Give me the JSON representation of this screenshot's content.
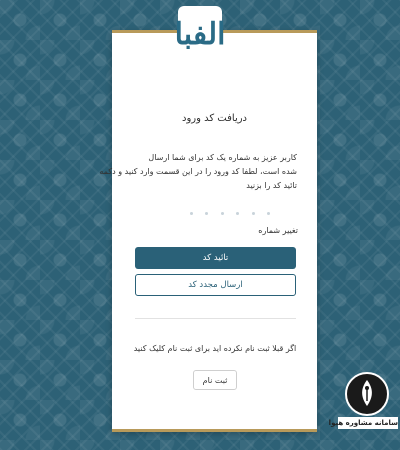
{
  "logo": {
    "text": "الفبا"
  },
  "form": {
    "title": "دریافت کد ورود",
    "description_lines": [
      "کاربر عزیز به شماره          یک کد برای شما ارسال",
      "شده است، لطفا کد ورود را در این قسمت وارد کنید و دکمه",
      "تائید کد را بزنید"
    ],
    "change_number_label": "تغییر شماره",
    "confirm_button_label": "تائید کد",
    "resend_button_label": "ارسال مجدد کد",
    "register_prompt": "اگر قبلا ثبت نام نکرده اید برای ثبت نام کلیک کنید",
    "register_button_label": "ثبت نام"
  },
  "watermark": {
    "text": "سامانه مشاوره هپوا"
  },
  "colors": {
    "background": "#2d6176",
    "primary": "#2a6178",
    "gold_accent": "#b89a5a",
    "logo": "#2a6b86"
  },
  "icons": {
    "logo": "alefba-logo",
    "watermark": "pen-nib-icon"
  }
}
